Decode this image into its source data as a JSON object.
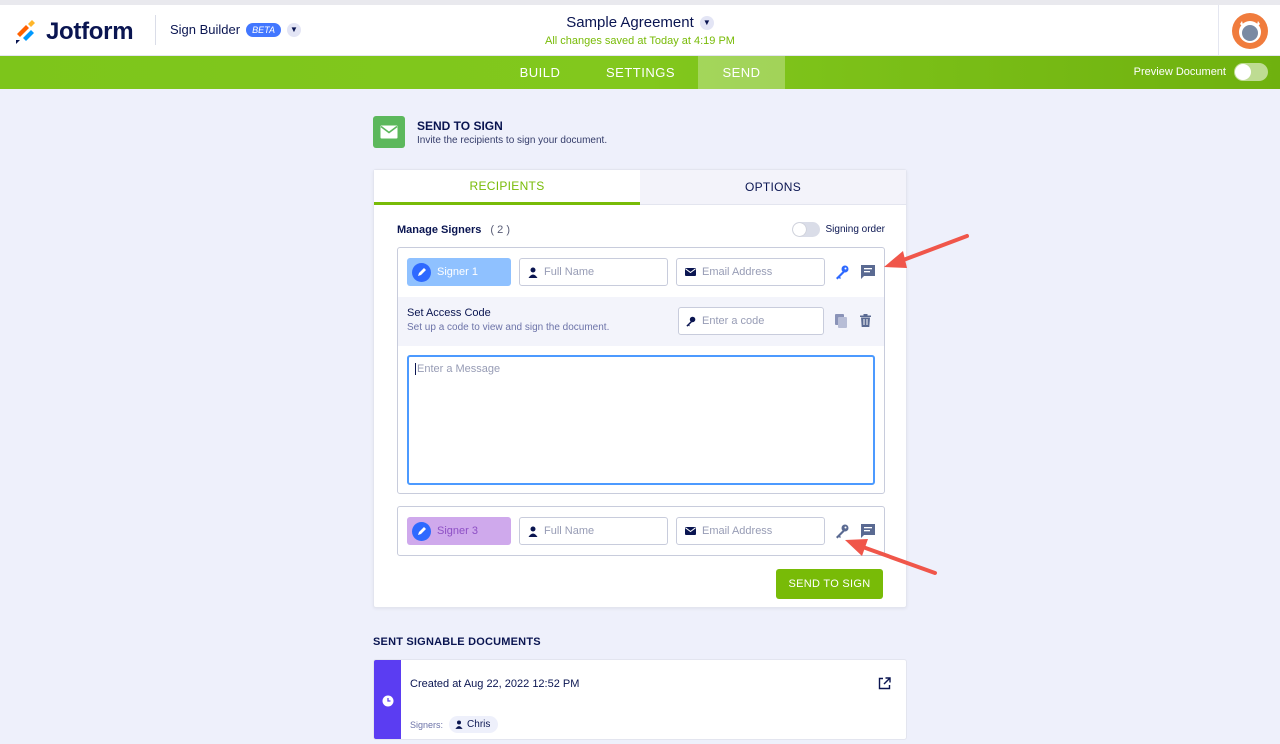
{
  "header": {
    "logo_text": "Jotform",
    "builder_name": "Sign Builder",
    "beta_badge": "BETA",
    "doc_title": "Sample Agreement",
    "saved_status": "All changes saved at Today at 4:19 PM"
  },
  "nav": {
    "tabs": [
      {
        "label": "BUILD"
      },
      {
        "label": "SETTINGS"
      },
      {
        "label": "SEND",
        "active": true
      }
    ],
    "preview_label": "Preview Document"
  },
  "send_section": {
    "title": "SEND TO SIGN",
    "subtitle": "Invite the recipients to sign your document."
  },
  "card": {
    "tabs": [
      {
        "label": "RECIPIENTS",
        "active": true
      },
      {
        "label": "OPTIONS",
        "active": false
      }
    ],
    "manage_signers_label": "Manage Signers",
    "signer_count": "( 2 )",
    "signing_order_label": "Signing order",
    "signers": [
      {
        "label": "Signer 1",
        "name_placeholder": "Full Name",
        "email_placeholder": "Email Address",
        "access_code": {
          "title": "Set Access Code",
          "description": "Set up a code to view and sign the document.",
          "placeholder": "Enter a code"
        },
        "message_placeholder": "Enter a Message"
      },
      {
        "label": "Signer 3",
        "name_placeholder": "Full Name",
        "email_placeholder": "Email Address"
      }
    ],
    "send_button": "SEND TO SIGN"
  },
  "sent_documents": {
    "title": "SENT SIGNABLE DOCUMENTS",
    "items": [
      {
        "created": "Created at Aug 22, 2022 12:52 PM",
        "signers_label": "Signers:",
        "signers": [
          "Chris"
        ]
      }
    ]
  },
  "colors": {
    "brand_green": "#78bb07",
    "navy": "#0a1551",
    "signer1": "#8fc1ff",
    "signer2": "#cfa9ec",
    "accent_purple": "#5b3df2",
    "annotation_arrow": "#f0564a"
  }
}
